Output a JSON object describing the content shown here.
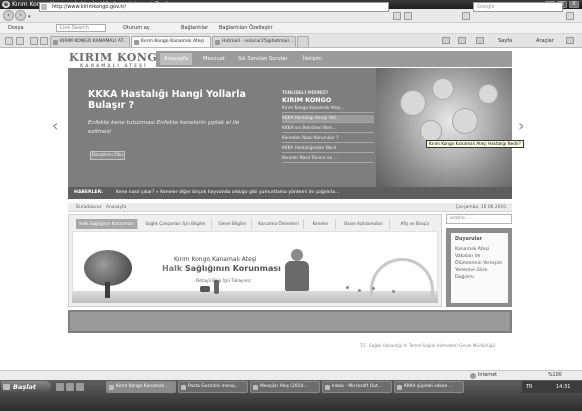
{
  "window": {
    "title": "Kırım Kongo Kanamalı Ateşi - Windows Internet Explorer",
    "minimize": "_",
    "maximize": "□",
    "close": "X"
  },
  "address": {
    "url": "http://www.kirimkongo.gov.tr/",
    "search_placeholder": "Google"
  },
  "links_bar": {
    "items": [
      "Dosya",
      "Live Search",
      "Oturum aç",
      "Bağlantılar",
      "Bağlantıları Özelleştir"
    ]
  },
  "tabs": [
    "KIRIM KONGO KANAMALI AT...",
    "Kırım Kongo Kanamalı Ateşi",
    "Hotmail - selacar25@hotmail...."
  ],
  "command_bar": {
    "page": "Sayfa",
    "tools": "Araçlar"
  },
  "site": {
    "logo_top": "KIRIM KONGO",
    "logo_sub": "KANAMALI ATEŞİ",
    "nav": [
      "Anasayfa",
      "Mevzuat",
      "Sık Sorulan Sorular",
      "İletişim"
    ],
    "hero": {
      "title": "KKKA Hastalığı Hangi Yollarla Bulaşır ?",
      "text": "Enfekte kene tutunması Enfekte kenelerin çıplak el ile ezilmesi",
      "button": "Devamını Oku",
      "menu_head": "TENLİDELİ MİSİNİZ?",
      "menu_title": "KIRIM KONGO",
      "menu_items": [
        "Kırım Kongo Kanamalı Ateş...",
        "KKKA Hastalığı Hangi Yoll...",
        "KKKA'nın Belirtileri Ned...",
        "Keneden Nasıl Korunulur ?",
        "KKKA Hastalığından Nasıl",
        "Keneler Nasıl Tanınır ve ..."
      ],
      "tooltip": "Kırım Kongo Kanamalı Ateşi Hastalığı Nedir?",
      "prev": "‹",
      "next": "›"
    },
    "ticker": {
      "label": "HABERLER:",
      "text": "Kene nasıl çıkar? » Keneler diğer birçok hayvanda olduğu gibi yumurtlama yöntemi ile çoğalırla..."
    },
    "breadcrumb": {
      "items": [
        "Buradasınız",
        "Anasayfa"
      ],
      "date": "Çarşamba, 16 06 2010"
    },
    "subtabs": [
      "Halk Sağlığının Korunması",
      "Sağlık Çalışanları İçin Bilgiler",
      "Genel Bilgiler",
      "Korunma Önlemleri",
      "Keneler",
      "Basın Açıklamaları",
      "Afiş ve Broşür"
    ],
    "banner": {
      "line1": "Kırım Kongo Kanamalı Ateşi",
      "line2_a": "Halk",
      "line2_b": "Sağlığının Korunması",
      "line3": "Detaylı Bilgi İçin Tıklayınız"
    },
    "search_placeholder": "arama ...",
    "sidebar": {
      "title": "Duyurular",
      "items": [
        "Kanamalı Ateşi",
        "Vakaları Ve",
        "Ölümlerinin Yerleşim",
        "Yerlerine Göre",
        "Dağılımı"
      ]
    },
    "copyright": "T.C. Sağlık Bakanlığı © Temel Sağlık Hizmetleri Genel Müdürlüğü"
  },
  "status": {
    "zone": "Internet",
    "zoom": "%100"
  },
  "taskbar": {
    "start": "Başlat",
    "items": [
      "Kırım Kongo Kanamalı ...",
      "Posta Gezintisi mesaj...",
      "Mesajlar Akış (2010-...",
      "Inbox - Microsoft Out...",
      "KKKA şüpheli vakan ..."
    ],
    "tray_lang": "TR",
    "clock": "14:31"
  }
}
